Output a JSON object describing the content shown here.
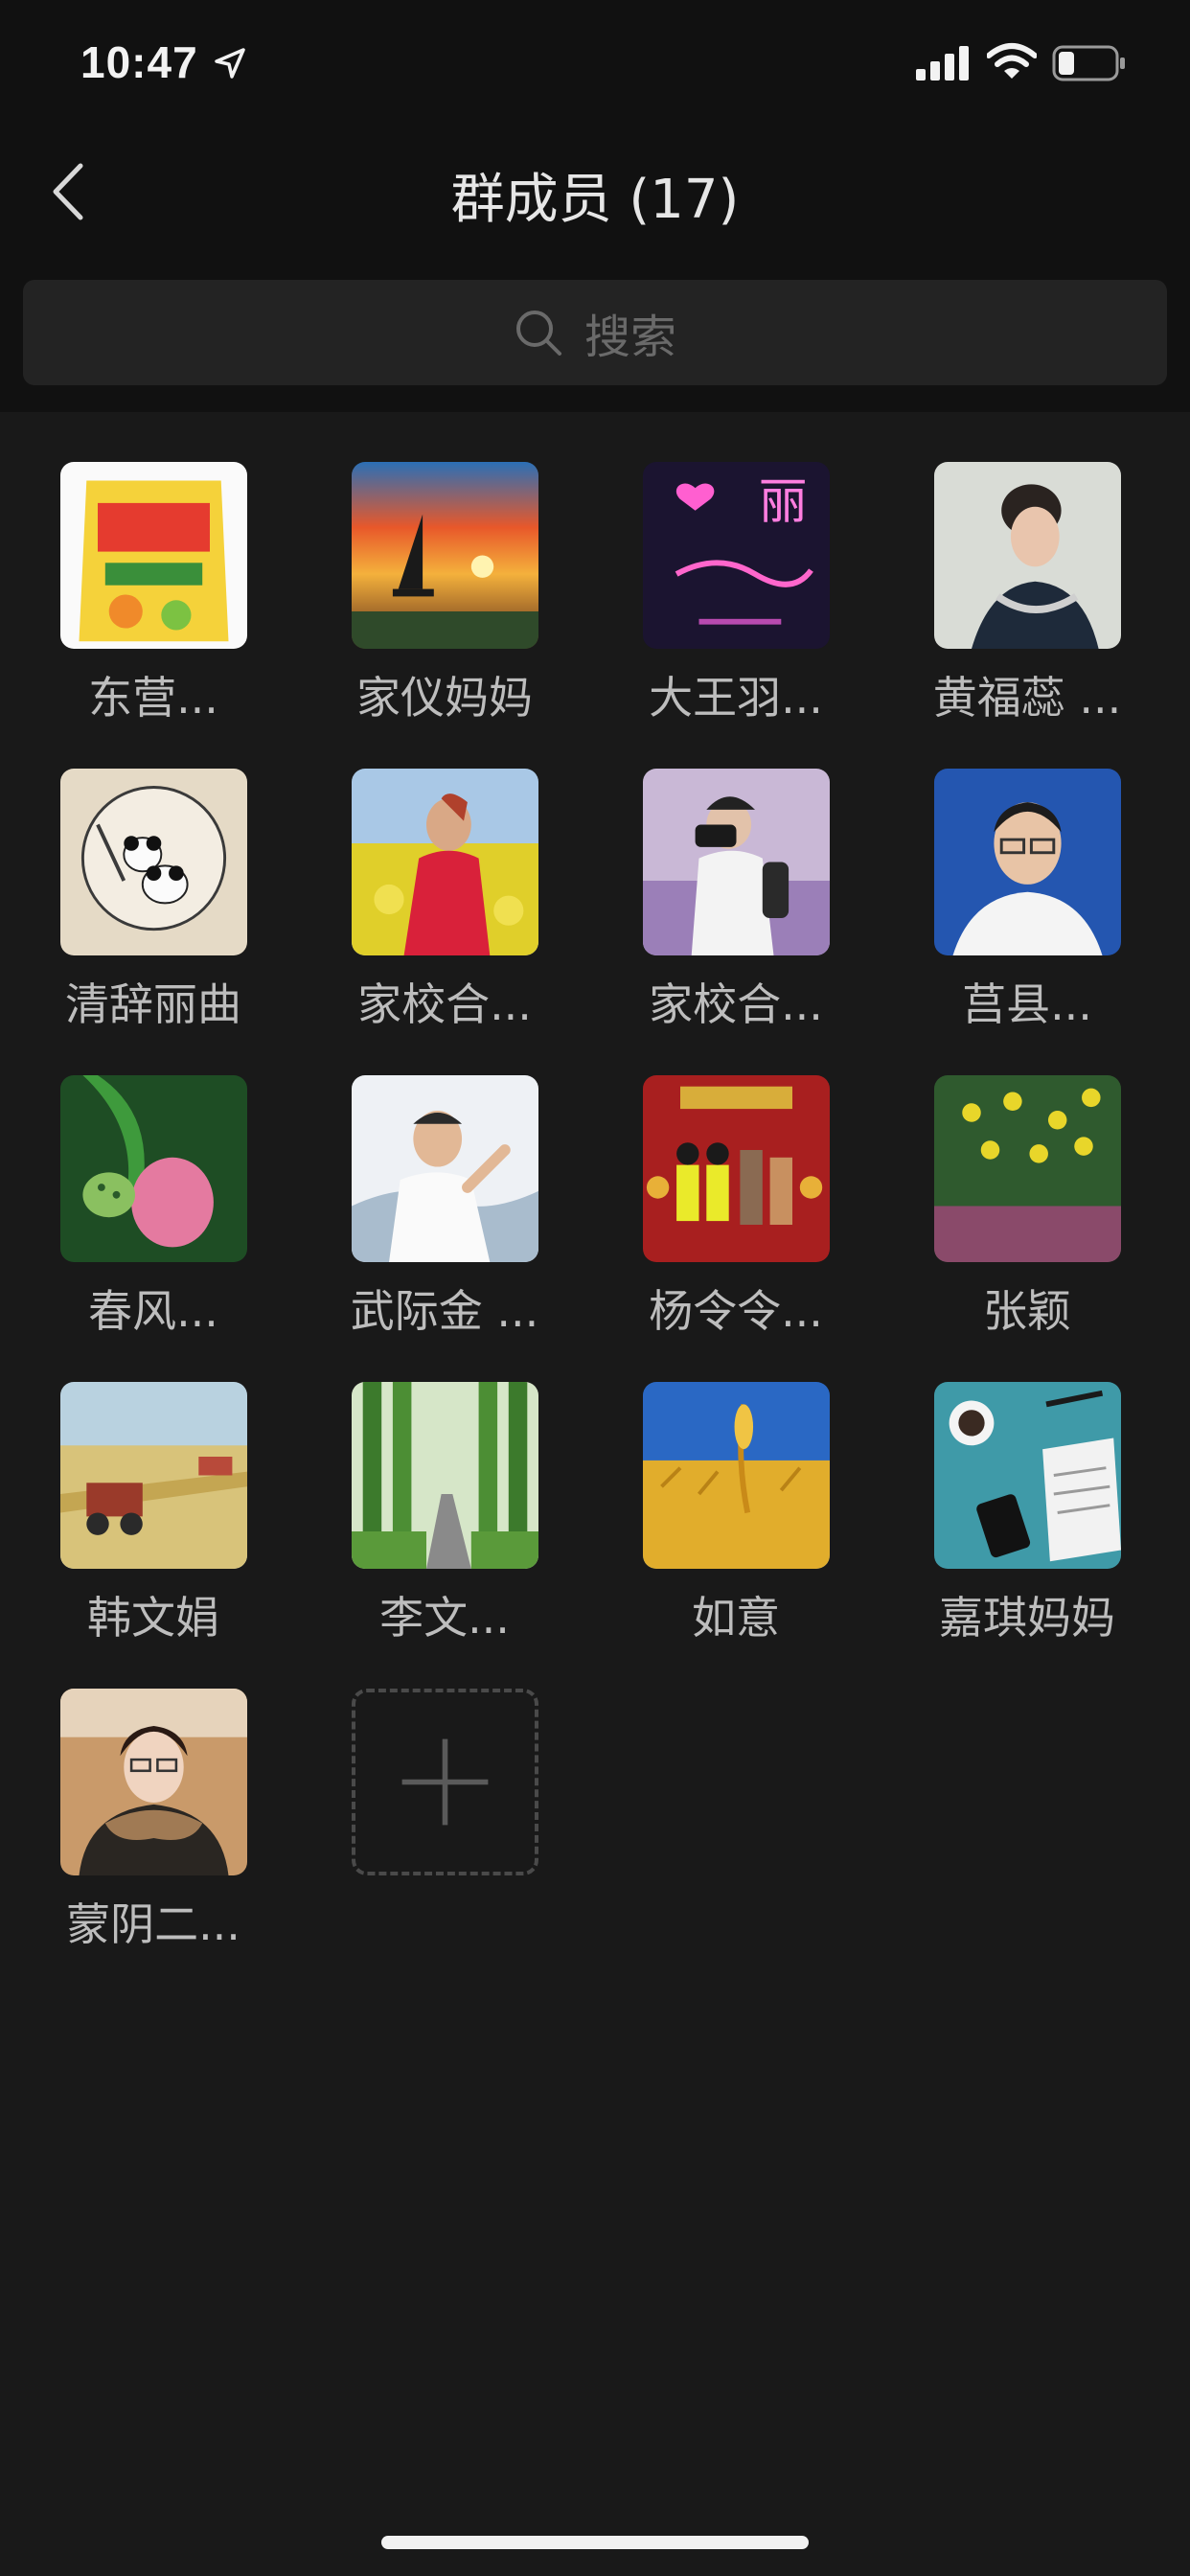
{
  "status_bar": {
    "time": "10:47",
    "icons": [
      "location-arrow-icon",
      "signal-icon",
      "wifi-icon",
      "battery-icon"
    ]
  },
  "nav": {
    "back_icon": "chevron-left-icon",
    "title": "群成员 (17)"
  },
  "search": {
    "icon": "search-icon",
    "placeholder": "搜索"
  },
  "members": [
    {
      "name": "东营..."
    },
    {
      "name": "家仪妈妈"
    },
    {
      "name": "大王羽..."
    },
    {
      "name": "黄福蕊 ..."
    },
    {
      "name": "清辞丽曲"
    },
    {
      "name": "家校合..."
    },
    {
      "name": "家校合..."
    },
    {
      "name": "莒县..."
    },
    {
      "name": "春风..."
    },
    {
      "name": "武际金 ..."
    },
    {
      "name": "杨令令..."
    },
    {
      "name": "张颖"
    },
    {
      "name": "韩文娟"
    },
    {
      "name": "李文..."
    },
    {
      "name": "如意"
    },
    {
      "name": "嘉琪妈妈"
    },
    {
      "name": "蒙阴二..."
    }
  ],
  "avatar_art": {
    "m3_text": "丽"
  },
  "add_member": {
    "icon": "plus-icon"
  },
  "colors": {
    "background": "#191919",
    "header": "#111111",
    "search_field": "#232323",
    "text": "#bdbdbd"
  }
}
